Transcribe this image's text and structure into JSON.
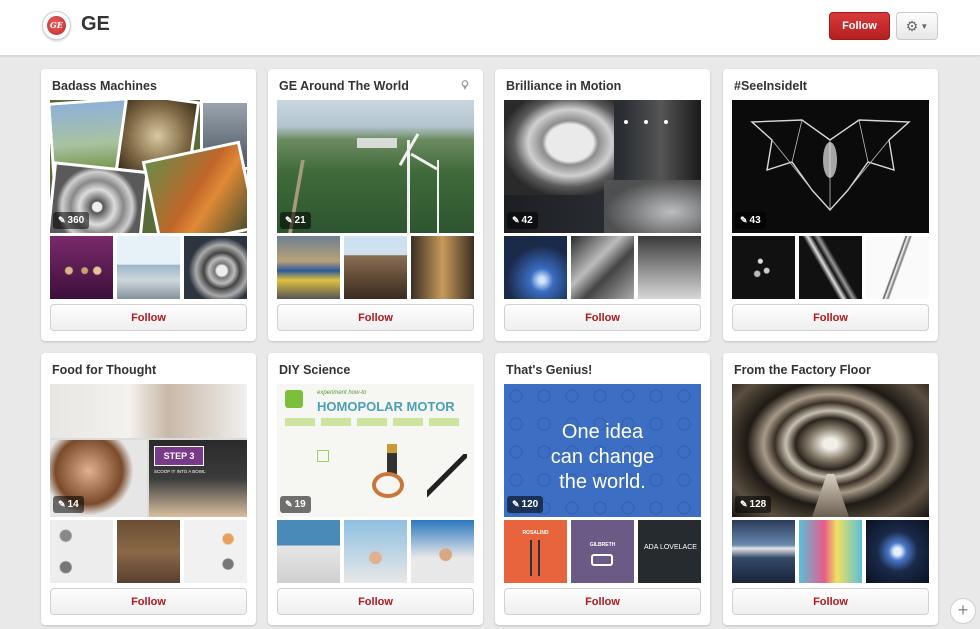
{
  "header": {
    "brand": "GE",
    "logo_text": "GE",
    "follow_label": "Follow",
    "settings_icon": "gear-icon"
  },
  "boards": [
    {
      "title": "Badass Machines",
      "count": "360",
      "follow_label": "Follow",
      "has_location": false
    },
    {
      "title": "GE Around The World",
      "count": "21",
      "follow_label": "Follow",
      "has_location": true
    },
    {
      "title": "Brilliance in Motion",
      "count": "42",
      "follow_label": "Follow",
      "has_location": false
    },
    {
      "title": "#SeeInsideIt",
      "count": "43",
      "follow_label": "Follow",
      "has_location": false
    },
    {
      "title": "Food for Thought",
      "count": "14",
      "follow_label": "Follow",
      "has_location": false
    },
    {
      "title": "DIY Science",
      "count": "19",
      "follow_label": "Follow",
      "has_location": false
    },
    {
      "title": "That's Genius!",
      "count": "120",
      "follow_label": "Follow",
      "has_location": false
    },
    {
      "title": "From the Factory Floor",
      "count": "128",
      "follow_label": "Follow",
      "has_location": false
    }
  ],
  "cover_text": {
    "food_step": "STEP 3",
    "food_step_sub": "SCOOP IT INTO A BOWL",
    "diy_heading": "HOMOPOLAR MOTOR",
    "diy_sub": "experiment how-to",
    "genius_line1": "One idea",
    "genius_line2": "can change",
    "genius_line3": "the world.",
    "genius_thumb1": "ROSALIND",
    "genius_thumb2": "GILBRETH",
    "genius_thumb3": "ADA LOVELACE"
  },
  "colors": {
    "accent_red": "#c42a2a",
    "follow_text": "#b3181f",
    "genius_blue": "#3c6fc4"
  }
}
